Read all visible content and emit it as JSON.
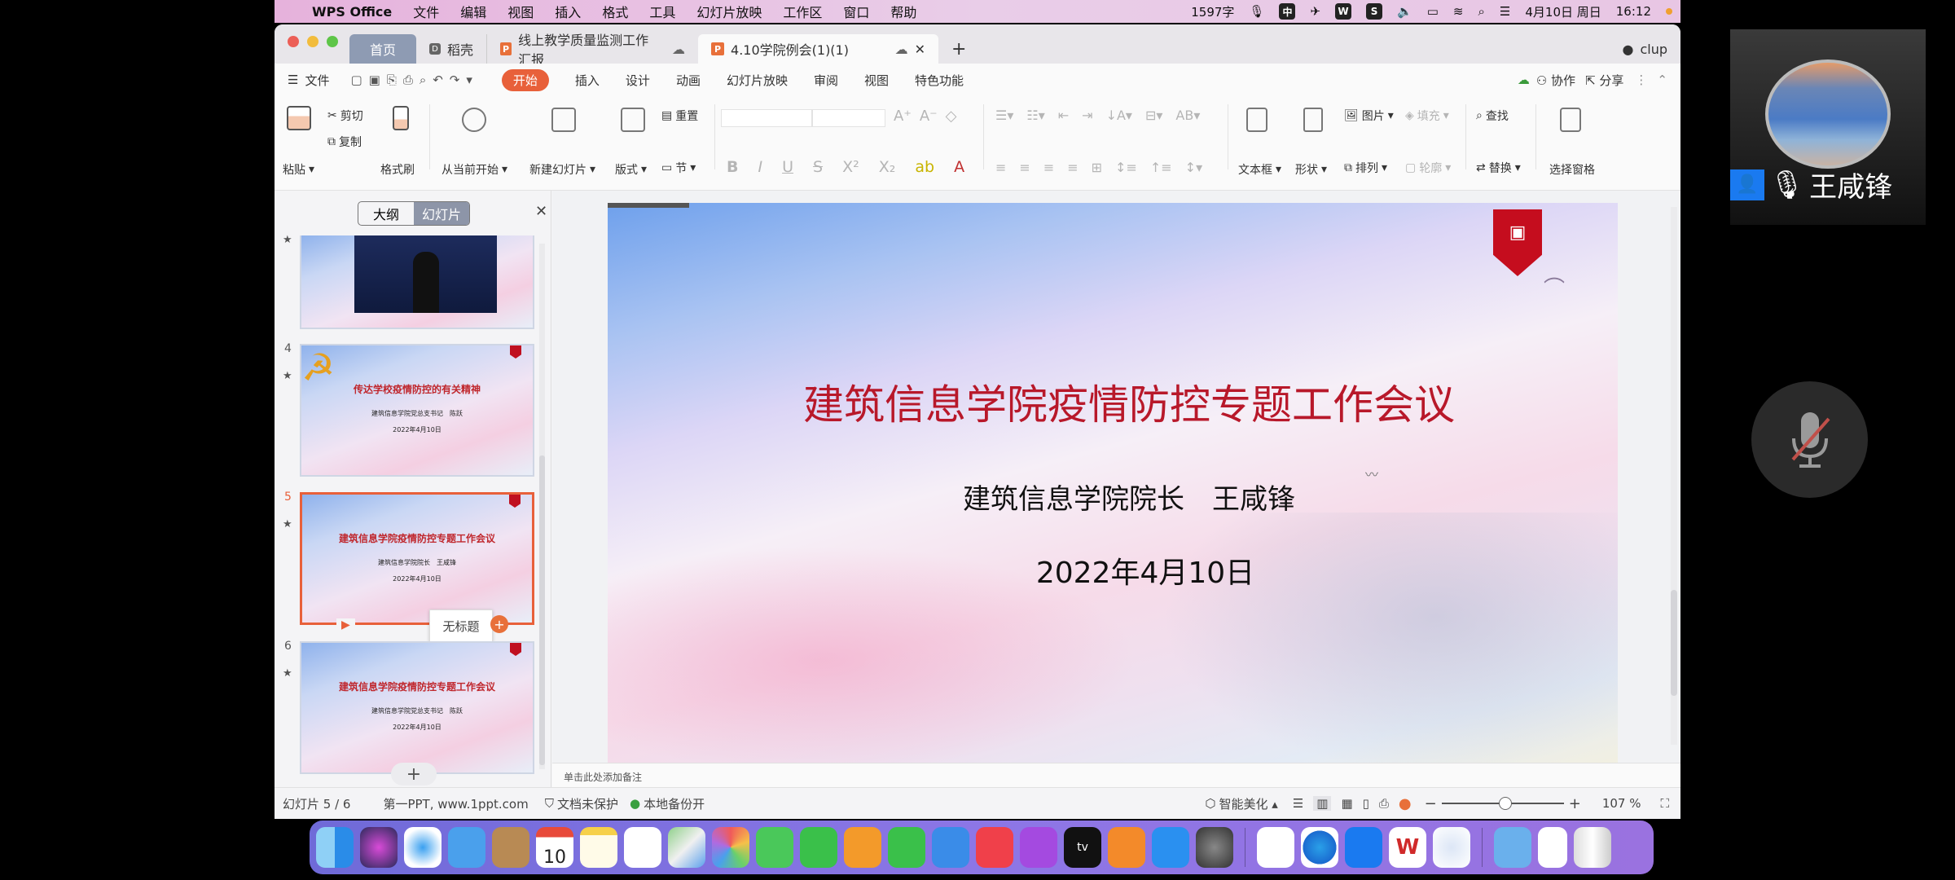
{
  "menubar": {
    "app_name": "WPS Office",
    "items": [
      "文件",
      "编辑",
      "视图",
      "插入",
      "格式",
      "工具",
      "幻灯片放映",
      "工作区",
      "窗口",
      "帮助"
    ],
    "word_count": "1597字",
    "input_method": "中",
    "date": "4月10日 周日",
    "time": "16:12"
  },
  "tabs": {
    "home": "首页",
    "docer": "稻壳",
    "doc1": "线上教学质量监测工作汇报",
    "doc2": "4.10学院例会(1)(1)",
    "user": "clup"
  },
  "ribbon_tabs": {
    "file": "文件",
    "items": [
      "开始",
      "插入",
      "设计",
      "动画",
      "幻灯片放映",
      "审阅",
      "视图",
      "特色功能"
    ],
    "collab": "协作",
    "share": "分享"
  },
  "toolbar": {
    "paste": "粘贴",
    "cut": "剪切",
    "copy": "复制",
    "format_painter": "格式刷",
    "play_from_current": "从当前开始",
    "new_slide": "新建幻灯片",
    "layout": "版式",
    "reset": "重置",
    "section": "节",
    "textbox": "文本框",
    "shape": "形状",
    "picture": "图片",
    "fill": "填充",
    "arrange": "排列",
    "outline": "轮廓",
    "find": "查找",
    "replace": "替换",
    "selection_pane": "选择窗格"
  },
  "left_panel": {
    "outline_tab": "大纲",
    "slides_tab": "幻灯片",
    "tooltip": "无标题",
    "slides": [
      {
        "num": "",
        "title": "",
        "subtitle": "",
        "date": ""
      },
      {
        "num": "4",
        "title": "传达学校疫情防控的有关精神",
        "subtitle": "建筑信息学院党总支书记　陈跃",
        "date": "2022年4月10日"
      },
      {
        "num": "5",
        "title": "建筑信息学院疫情防控专题工作会议",
        "subtitle": "建筑信息学院院长　王咸锋",
        "date": "2022年4月10日"
      },
      {
        "num": "6",
        "title": "建筑信息学院疫情防控专题工作会议",
        "subtitle": "建筑信息学院党总支书记　陈跃",
        "date": "2022年4月10日"
      }
    ]
  },
  "slide": {
    "title": "建筑信息学院疫情防控专题工作会议",
    "subtitle": "建筑信息学院院长　王咸锋",
    "date": "2022年4月10日"
  },
  "notes_placeholder": "单击此处添加备注",
  "status": {
    "slide_counter": "幻灯片 5 / 6",
    "theme": "第一PPT, www.1ppt.com",
    "protection": "文档未保护",
    "backup": "本地备份开",
    "beautify": "智能美化",
    "zoom": "107 %",
    "zoom_value": 107
  },
  "video": {
    "participant_name": "王咸锋"
  },
  "colors": {
    "accent": "#e8603a",
    "slide_title": "#b8182a",
    "badge": "#c50d1e"
  }
}
